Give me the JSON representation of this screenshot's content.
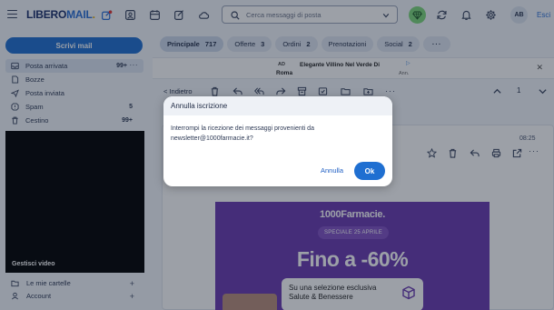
{
  "app": {
    "logo_main": "LIBERO",
    "logo_accent": "MAIL",
    "logo_dot": "."
  },
  "topbar": {
    "search_placeholder": "Cerca messaggi di posta",
    "avatar_initials": "AB",
    "logout_label": "Esci"
  },
  "sidebar": {
    "compose_label": "Scrivi mail",
    "folders": [
      {
        "label": "Posta arrivata",
        "count": "99+",
        "more": "···"
      },
      {
        "label": "Bozze",
        "count": ""
      },
      {
        "label": "Posta inviata",
        "count": ""
      },
      {
        "label": "Spam",
        "count": "5"
      },
      {
        "label": "Cestino",
        "count": "99+"
      }
    ],
    "video_label": "Gestisci video",
    "bottom": [
      {
        "label": "Le mie cartelle",
        "action": "+"
      },
      {
        "label": "Account",
        "action": "+"
      }
    ]
  },
  "tabs": [
    {
      "label": "Principale",
      "count": "717"
    },
    {
      "label": "Offerte",
      "count": "3"
    },
    {
      "label": "Ordini",
      "count": "2"
    },
    {
      "label": "Prenotazioni",
      "count": ""
    },
    {
      "label": "Social",
      "count": "2"
    },
    {
      "label": "···",
      "count": ""
    }
  ],
  "ad": {
    "ad_badge": "AD",
    "location": "Roma",
    "headline": "Elegante Villino Nel Verde Di",
    "ann": "Ann.",
    "close": "✕"
  },
  "toolbar": {
    "back_label": "Indietro",
    "page": "1",
    "more": "···"
  },
  "message": {
    "time": "08:25"
  },
  "promo": {
    "brand": "1000Farmacie.",
    "pill": "SPECIALE 25 APRILE",
    "headline": "Fino a -60%",
    "card_line1": "Su una selezione esclusiva",
    "card_line2": "Salute & Benessere"
  },
  "dialog": {
    "title": "Annulla iscrizione",
    "body": "Interrompi la ricezione dei messaggi provenienti da newsletter@1000farmacie.it?",
    "cancel_label": "Annulla",
    "ok_label": "Ok"
  },
  "colors": {
    "primary": "#1f6fd1",
    "promo_bg": "#6a3ab0",
    "gem_bg": "#7dd87a"
  }
}
